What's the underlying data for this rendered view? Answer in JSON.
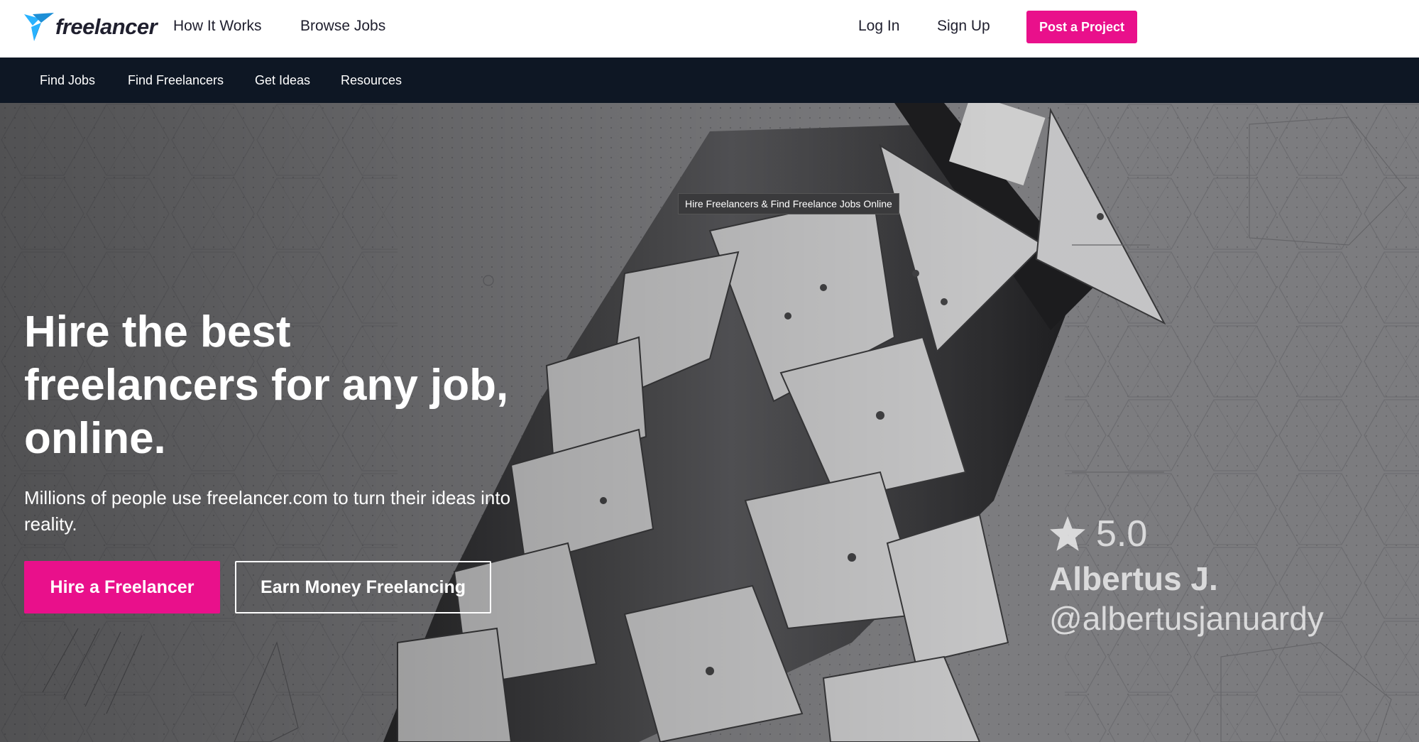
{
  "header": {
    "logo_text": "freelancer",
    "nav": [
      "How It Works",
      "Browse Jobs"
    ],
    "login_label": "Log In",
    "signup_label": "Sign Up",
    "post_project_label": "Post a Project"
  },
  "subnav": {
    "items": [
      "Find Jobs",
      "Find Freelancers",
      "Get Ideas",
      "Resources"
    ]
  },
  "hero": {
    "tooltip": "Hire Freelancers & Find Freelance Jobs Online",
    "title": "Hire the best freelancers for any job, online.",
    "subtitle": "Millions of people use freelancer.com to turn their ideas into reality.",
    "hire_button": "Hire a Freelancer",
    "earn_button": "Earn Money Freelancing",
    "credit": {
      "rating": "5.0",
      "name": "Albertus J.",
      "handle": "@albertusjanuardy"
    }
  },
  "colors": {
    "brand_pink": "#e9108b",
    "nav_dark": "#0e1724",
    "logo_blue": "#29b2fe"
  },
  "icons": [
    "bird-logo-icon",
    "star-icon"
  ]
}
